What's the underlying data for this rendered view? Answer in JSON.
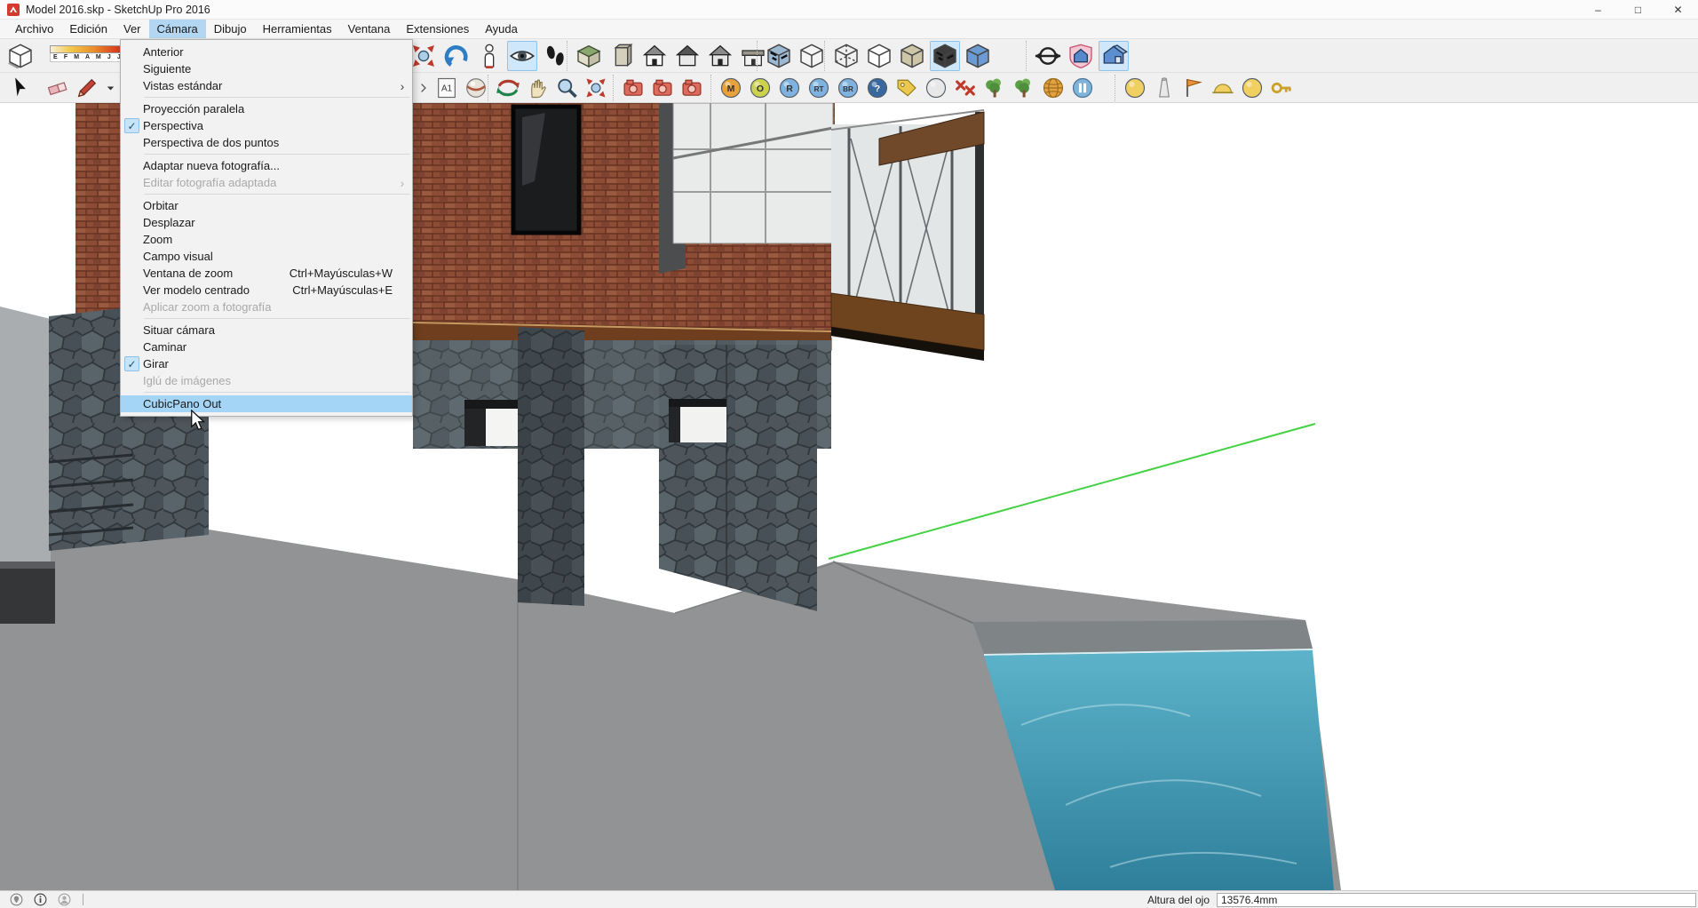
{
  "window": {
    "title": "Model 2016.skp - SketchUp Pro 2016",
    "controls": [
      {
        "name": "minimize-button",
        "glyph": "–"
      },
      {
        "name": "maximize-button",
        "glyph": "□"
      },
      {
        "name": "close-button",
        "glyph": "✕"
      }
    ]
  },
  "menu_bar": {
    "items": [
      {
        "label": "Archivo"
      },
      {
        "label": "Edición"
      },
      {
        "label": "Ver"
      },
      {
        "label": "Cámara",
        "active": true
      },
      {
        "label": "Dibujo"
      },
      {
        "label": "Herramientas"
      },
      {
        "label": "Ventana"
      },
      {
        "label": "Extensiones"
      },
      {
        "label": "Ayuda"
      }
    ]
  },
  "camera_menu": {
    "items": [
      {
        "label": "Anterior"
      },
      {
        "label": "Siguiente"
      },
      {
        "label": "Vistas estándar",
        "submenu": true,
        "separator_after": true
      },
      {
        "label": "Proyección paralela"
      },
      {
        "label": "Perspectiva",
        "checked": true
      },
      {
        "label": "Perspectiva de dos puntos",
        "separator_after": true
      },
      {
        "label": "Adaptar nueva fotografía..."
      },
      {
        "label": "Editar fotografía adaptada",
        "disabled": true,
        "submenu": true,
        "separator_after": true
      },
      {
        "label": "Orbitar"
      },
      {
        "label": "Desplazar"
      },
      {
        "label": "Zoom"
      },
      {
        "label": "Campo visual"
      },
      {
        "label": "Ventana de zoom",
        "shortcut": "Ctrl+Mayúsculas+W"
      },
      {
        "label": "Ver modelo centrado",
        "shortcut": "Ctrl+Mayúsculas+E"
      },
      {
        "label": "Aplicar zoom a fotografía",
        "disabled": true,
        "separator_after": true
      },
      {
        "label": "Situar cámara"
      },
      {
        "label": "Caminar"
      },
      {
        "label": "Girar",
        "checked": true
      },
      {
        "label": "Iglú de imágenes",
        "disabled": true,
        "separator_after": true
      },
      {
        "label": "CubicPano Out",
        "highlighted": true
      }
    ]
  },
  "shadow_toolbar": {
    "months": "E F M A M J J A S"
  },
  "toolbar_row1": {
    "groups": [
      [
        {
          "name": "shadow-dialog-icon",
          "shape": "bigcube"
        }
      ],
      [
        {
          "name": "zoom-extents-icon",
          "shape": "zoomext"
        },
        {
          "name": "previous-view-icon",
          "shape": "prevarrow"
        },
        {
          "name": "position-camera-icon",
          "shape": "person"
        },
        {
          "name": "look-around-icon",
          "shape": "eye",
          "active": true
        },
        {
          "name": "walk-icon",
          "shape": "footprints"
        }
      ],
      [
        {
          "name": "iso-view-icon",
          "shape": "houseiso"
        },
        {
          "name": "top-view-icon",
          "shape": "housetall"
        },
        {
          "name": "front-view-icon",
          "shape": "housefront"
        },
        {
          "name": "back-view-icon",
          "shape": "houseback"
        },
        {
          "name": "right-view-icon",
          "shape": "housefront",
          "fill": "#e6e6e6"
        },
        {
          "name": "left-view-icon",
          "shape": "houseflat"
        }
      ],
      [
        {
          "name": "xray-mode-icon",
          "shape": "cube",
          "fill": "#9db9d2",
          "tex": true
        },
        {
          "name": "back-edges-icon",
          "shape": "cube",
          "fill": "#f4f4f4"
        }
      ],
      [
        {
          "name": "wireframe-style-icon",
          "shape": "wirecube"
        },
        {
          "name": "hidden-line-style-icon",
          "shape": "cube",
          "fill": "#ffffff"
        },
        {
          "name": "shaded-style-icon",
          "shape": "cube",
          "fill": "#cdc5a8"
        },
        {
          "name": "shaded-textures-style-icon",
          "shape": "cube",
          "fill": "#3c3c3c",
          "tex": true,
          "active": true
        },
        {
          "name": "monochrome-style-icon",
          "shape": "cube",
          "fill": "#6b9bd2"
        }
      ],
      [
        {
          "name": "look-around-compass-icon",
          "shape": "compass"
        },
        {
          "name": "photo-match-icon",
          "shape": "shieldhouse"
        },
        {
          "name": "image-igloo-icon",
          "shape": "bluehouse3d",
          "active": true
        }
      ]
    ]
  },
  "toolbar_row2": {
    "groups": [
      [
        {
          "name": "select-tool-icon",
          "shape": "cursorsel"
        }
      ],
      [
        {
          "name": "eraser-tool-icon",
          "shape": "eraser"
        },
        {
          "name": "line-tool-icon",
          "shape": "pencil"
        },
        {
          "name": "line-tool-dropdown-icon",
          "shape": "caret"
        }
      ],
      [
        {
          "name": "toolbar-overflow-icon",
          "shape": "chevron"
        },
        {
          "name": "layout-export-icon",
          "shape": "a1doc"
        },
        {
          "name": "styles-icon",
          "shape": "spherestyle"
        }
      ],
      [
        {
          "name": "orbit-tool-icon",
          "shape": "orbit"
        },
        {
          "name": "pan-tool-icon",
          "shape": "hand"
        },
        {
          "name": "zoom-tool-icon",
          "shape": "magnifier"
        },
        {
          "name": "zoom-extents-tool-icon",
          "shape": "zoomext"
        }
      ],
      [
        {
          "name": "photo-export-icon",
          "shape": "redcam"
        },
        {
          "name": "render-export-icon",
          "shape": "redcam"
        },
        {
          "name": "animation-export-icon",
          "shape": "redcam"
        }
      ],
      [
        {
          "name": "vray-material-editor-icon",
          "shape": "ball",
          "color": "#e8a23c",
          "letter": "M"
        },
        {
          "name": "vray-options-icon",
          "shape": "ball",
          "color": "#cdd24e",
          "letter": "O"
        },
        {
          "name": "vray-render-icon",
          "shape": "ball",
          "color": "#7fb2de",
          "letter": "R"
        },
        {
          "name": "vray-rt-icon",
          "shape": "ball",
          "color": "#7fb2de",
          "letter": "RT"
        },
        {
          "name": "vray-batch-render-icon",
          "shape": "ball",
          "color": "#7fb2de",
          "letter": "BR"
        },
        {
          "name": "vray-help-icon",
          "shape": "ball",
          "color": "#39689e",
          "letter": "?",
          "text_color": "#ffffff"
        },
        {
          "name": "vray-frame-buffer-icon",
          "shape": "tag"
        },
        {
          "name": "vray-sphere-icon",
          "shape": "ball",
          "color": "#e8e8e8"
        },
        {
          "name": "vray-clear-icon",
          "shape": "xx"
        },
        {
          "name": "vray-proxy-icon",
          "shape": "tree"
        },
        {
          "name": "vray-fur-icon",
          "shape": "tree"
        },
        {
          "name": "vray-sun-icon",
          "shape": "globe"
        },
        {
          "name": "vray-pause-icon",
          "shape": "pause"
        }
      ],
      [
        {
          "name": "vray-omni-light-icon",
          "shape": "ball",
          "color": "#f0d060"
        },
        {
          "name": "vray-spot-light-icon",
          "shape": "spray"
        },
        {
          "name": "vray-rect-light-icon",
          "shape": "flag"
        },
        {
          "name": "vray-dome-light-icon",
          "shape": "domelight"
        },
        {
          "name": "vray-sphere-light-icon",
          "shape": "ball",
          "color": "#f0d060"
        },
        {
          "name": "vray-ies-light-icon",
          "shape": "key"
        }
      ]
    ]
  },
  "status_bar": {
    "icons": [
      {
        "name": "geolocation-icon",
        "shape": "geopin"
      },
      {
        "name": "credits-icon",
        "shape": "infocircle"
      },
      {
        "name": "account-icon",
        "shape": "personcircle"
      }
    ],
    "eye_height_label": "Altura del ojo",
    "eye_height_value": "13576.4mm"
  },
  "colors": {
    "menu_highlight": "#a5d5f6",
    "menubar_active": "#b3d7f2",
    "check_bg": "#c7e3f8",
    "axis_green": "#43d243"
  }
}
